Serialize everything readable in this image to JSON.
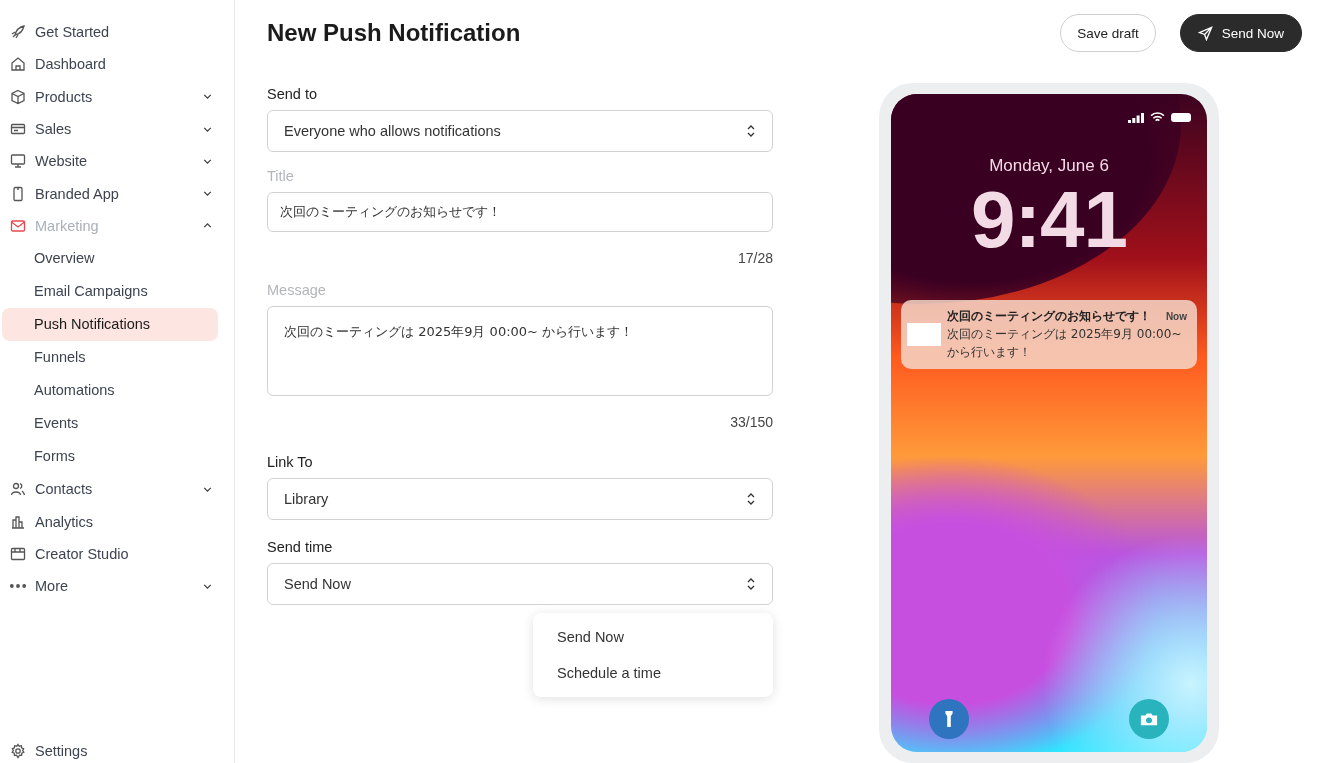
{
  "sidebar": {
    "items": [
      {
        "label": "Get Started",
        "kind": "link"
      },
      {
        "label": "Dashboard",
        "kind": "link"
      },
      {
        "label": "Products",
        "kind": "group",
        "expanded": false
      },
      {
        "label": "Sales",
        "kind": "group",
        "expanded": false
      },
      {
        "label": "Website",
        "kind": "group",
        "expanded": false
      },
      {
        "label": "Branded App",
        "kind": "group",
        "expanded": false
      },
      {
        "label": "Marketing",
        "kind": "group",
        "expanded": true,
        "children": [
          {
            "label": "Overview",
            "selected": false
          },
          {
            "label": "Email Campaigns",
            "selected": false
          },
          {
            "label": "Push Notifications",
            "selected": true
          },
          {
            "label": "Funnels",
            "selected": false
          },
          {
            "label": "Automations",
            "selected": false
          },
          {
            "label": "Events",
            "selected": false
          },
          {
            "label": "Forms",
            "selected": false
          }
        ]
      },
      {
        "label": "Contacts",
        "kind": "group",
        "expanded": false
      },
      {
        "label": "Analytics",
        "kind": "link"
      },
      {
        "label": "Creator Studio",
        "kind": "link"
      },
      {
        "label": "More",
        "kind": "group",
        "expanded": false
      }
    ],
    "footer": {
      "label": "Settings"
    }
  },
  "header": {
    "title": "New Push Notification",
    "buttons": [
      {
        "label": "Save draft",
        "kind": "secondary"
      },
      {
        "label": "Send Now",
        "kind": "primary"
      }
    ]
  },
  "form": {
    "send_to": {
      "label": "Send to",
      "value": "Everyone who allows notifications"
    },
    "title": {
      "label": "Title",
      "value": "次回のミーティングのお知らせです！",
      "counter": "17/28"
    },
    "message": {
      "label": "Message",
      "value": "次回のミーティングは 2025年9月 00:00~ から行います！",
      "counter": "33/150"
    },
    "link_to": {
      "label": "Link To",
      "value": "Library"
    },
    "send_time": {
      "label": "Send time",
      "value": "Send Now",
      "options": [
        "Send Now",
        "Schedule a time"
      ]
    }
  },
  "preview": {
    "date": "Monday, June 6",
    "time": "9:41",
    "notification": {
      "title": "次回のミーティングのお知らせです！",
      "time": "Now",
      "body": "次回のミーティングは 2025年9月 00:00~ から行います！"
    }
  }
}
